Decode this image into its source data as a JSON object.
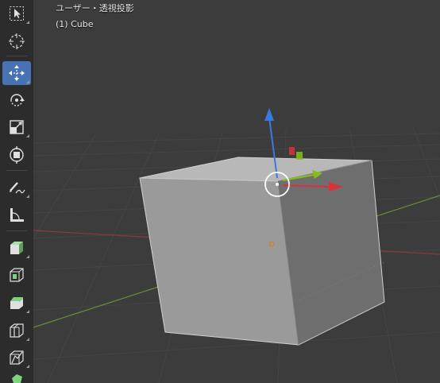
{
  "viewport": {
    "view_label": "ユーザー・透視投影",
    "object_label": "(1) Cube"
  },
  "colors": {
    "background": "#3c3c3c",
    "toolbar": "#2c2c2c",
    "active_tool": "#4772b3",
    "grid": "#454545",
    "x_axis": "#8a3a3a",
    "y_axis": "#6a8a3a",
    "gizmo_x": "#d8323a",
    "gizmo_y": "#84c018",
    "gizmo_z": "#3a7ae0",
    "cube_front": "#9a9a9a",
    "cube_top": "#b8b8b8",
    "cube_side": "#6e6e6e"
  },
  "toolbar": {
    "tools": [
      {
        "name": "select-box-tool",
        "icon": "select-box-icon",
        "active": false
      },
      {
        "name": "cursor-tool",
        "icon": "cursor-icon",
        "active": false
      },
      {
        "name": "move-tool",
        "icon": "move-icon",
        "active": true
      },
      {
        "name": "rotate-tool",
        "icon": "rotate-icon",
        "active": false
      },
      {
        "name": "scale-tool",
        "icon": "scale-icon",
        "active": false
      },
      {
        "name": "transform-tool",
        "icon": "transform-icon",
        "active": false
      },
      {
        "name": "annotate-tool",
        "icon": "annotate-icon",
        "active": false
      },
      {
        "name": "measure-tool",
        "icon": "measure-icon",
        "active": false
      },
      {
        "name": "add-cube-tool",
        "icon": "add-cube-icon",
        "active": false
      },
      {
        "name": "inset-faces-tool",
        "icon": "inset-faces-icon",
        "active": false
      },
      {
        "name": "bevel-tool",
        "icon": "bevel-icon",
        "active": false
      },
      {
        "name": "loop-cut-tool",
        "icon": "loop-cut-icon",
        "active": false
      },
      {
        "name": "knife-tool",
        "icon": "knife-icon",
        "active": false
      },
      {
        "name": "poly-build-tool",
        "icon": "poly-build-icon",
        "active": false
      }
    ]
  }
}
